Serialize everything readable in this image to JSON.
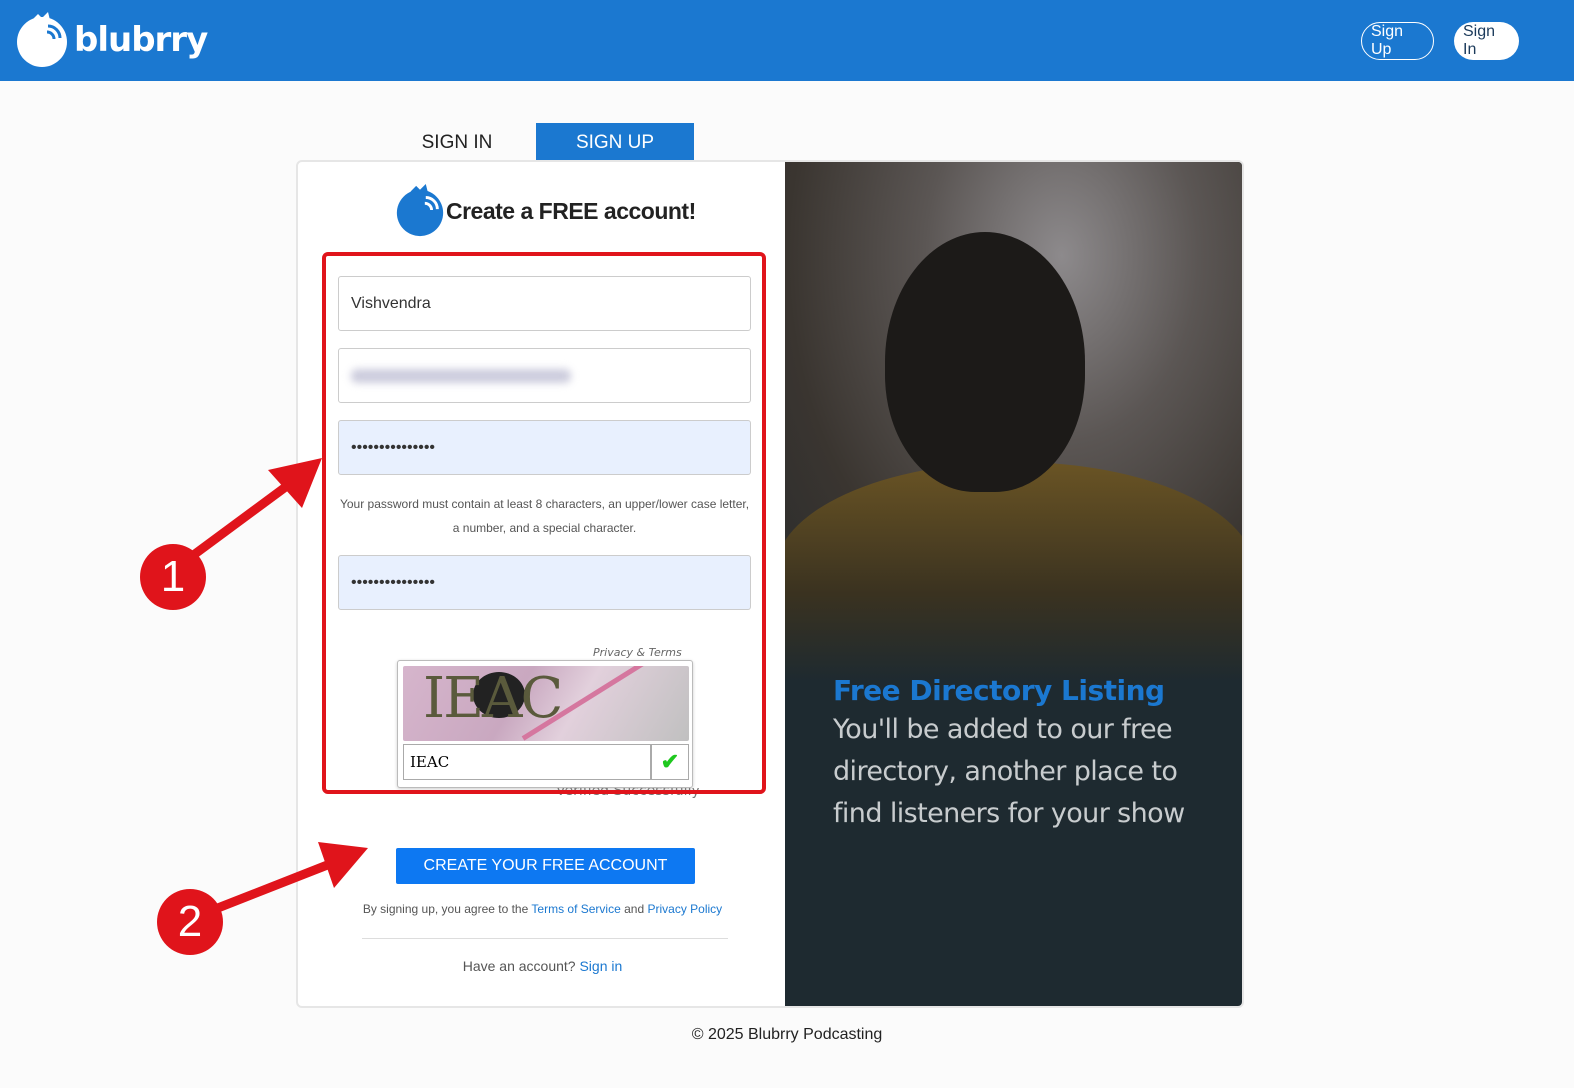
{
  "header": {
    "brand": "blubrry",
    "signup": "Sign Up",
    "signin": "Sign In",
    "color": "#1b78d0"
  },
  "tabs": [
    {
      "label": "SIGN IN",
      "active": false
    },
    {
      "label": "SIGN UP",
      "active": true
    }
  ],
  "form": {
    "heading": "Create a FREE account!",
    "name_value": "Vishvendra",
    "email_value": "(blurred)",
    "password_value": "•••••••••••••••",
    "password_hint": "Your password must contain at least 8 characters, an upper/lower case letter, a number, and a special character.",
    "confirm_value": "•••••••••••••••",
    "captcha_links": "Privacy & Terms",
    "captcha_image_text": "IEAC",
    "captcha_value": "IEAC",
    "captcha_status": "Verified Successfully",
    "submit": "CREATE YOUR FREE ACCOUNT",
    "terms_prefix": "By signing up, you agree to the",
    "terms_link": "Terms of Service",
    "terms_and": "and",
    "privacy_link": "Privacy Policy",
    "have_account": "Have an account?",
    "signin_link": "Sign in"
  },
  "promo": {
    "title": "Free Directory Listing",
    "body": "You'll be added to our free directory, another place to find listeners for your show"
  },
  "annotations": [
    "1",
    "2"
  ],
  "footer": "© 2025 Blubrry Podcasting"
}
